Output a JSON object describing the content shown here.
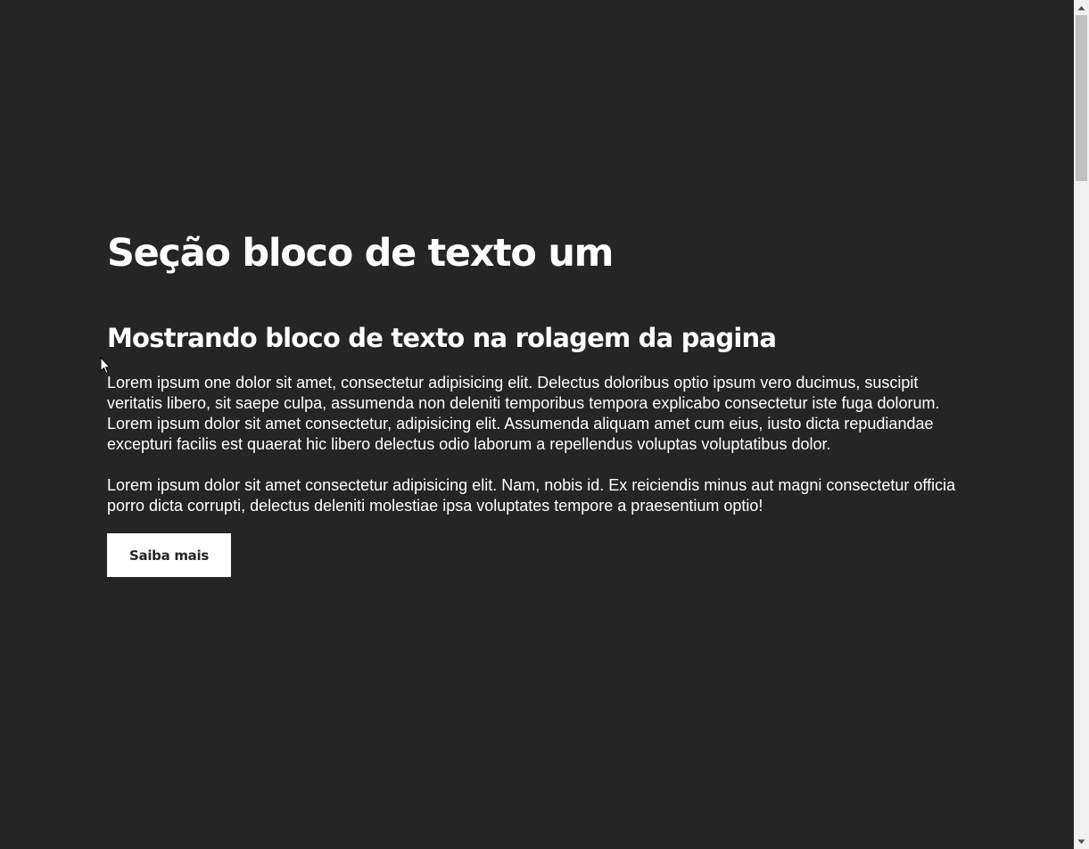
{
  "section": {
    "title": "Seção bloco de texto um",
    "subtitle": "Mostrando bloco de texto na rolagem da pagina",
    "paragraphs": [
      "Lorem ipsum one dolor sit amet, consectetur adipisicing elit. Delectus doloribus optio ipsum vero ducimus, suscipit veritatis libero, sit saepe culpa, assumenda non deleniti temporibus tempora explicabo consectetur iste fuga dolorum. Lorem ipsum dolor sit amet consectetur, adipisicing elit. Assumenda aliquam amet cum eius, iusto dicta repudiandae excepturi facilis est quaerat hic libero delectus odio laborum a repellendus voluptas voluptatibus dolor.",
      "Lorem ipsum dolor sit amet consectetur adipisicing elit. Nam, nobis id. Ex reiciendis minus aut magni consectetur officia porro dicta corrupti, delectus deleniti molestiae ipsa voluptates tempore a praesentium optio!"
    ],
    "button_label": "Saiba mais"
  },
  "colors": {
    "background": "#252525",
    "text": "#ffffff",
    "button_background": "#ffffff",
    "button_text": "#252525",
    "scrollbar_track": "#f1f1f1",
    "scrollbar_thumb": "#c1c1c1"
  },
  "icons": {
    "cursor": "mouse-pointer-icon",
    "scroll_up": "scroll-up-arrow-icon",
    "scroll_down": "scroll-down-arrow-icon"
  }
}
